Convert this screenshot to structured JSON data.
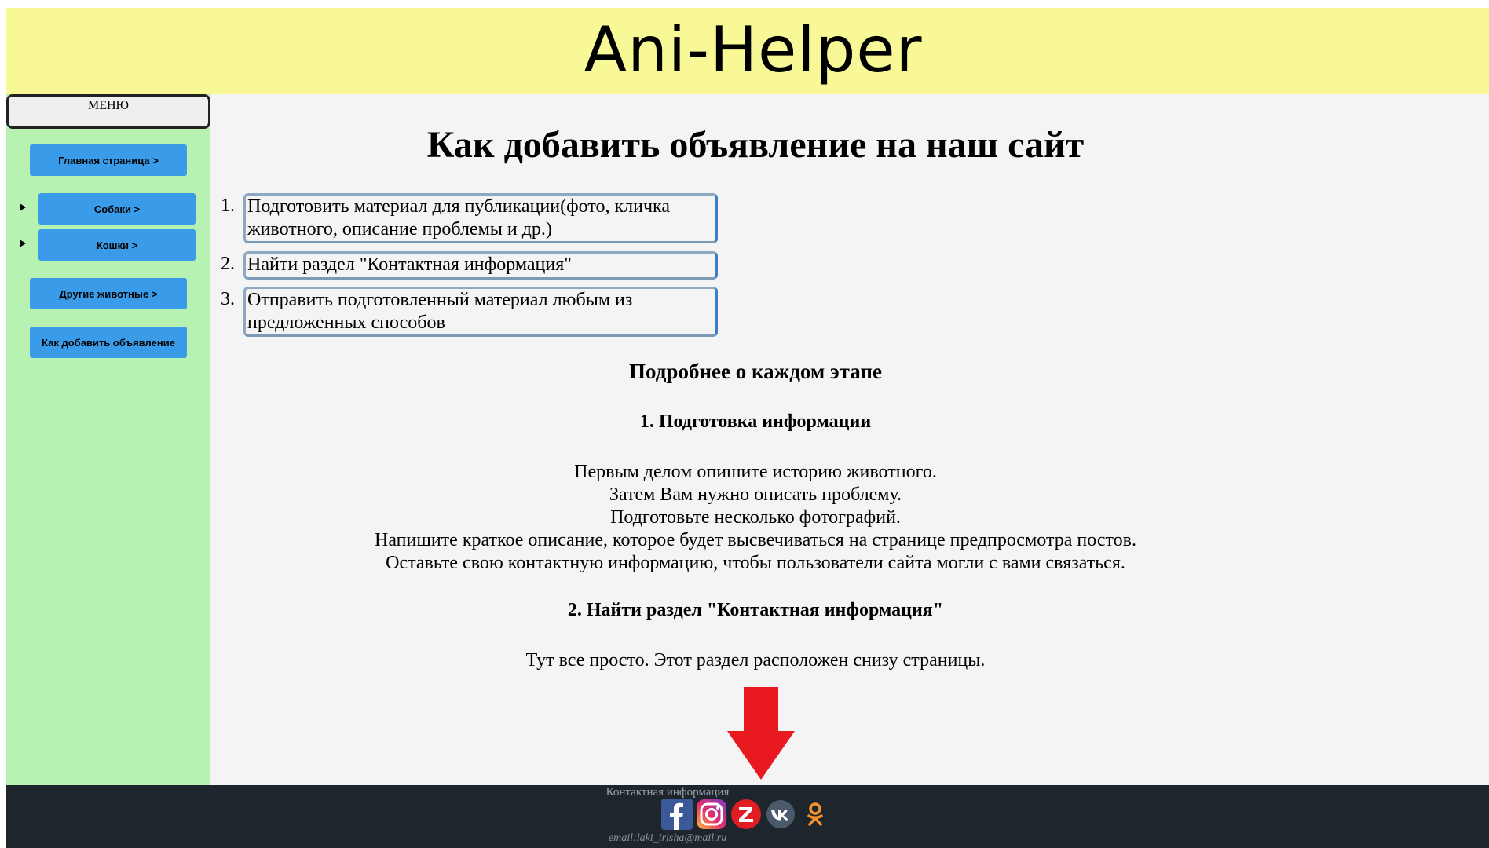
{
  "header": {
    "site_title": "Ani-Helper"
  },
  "sidebar": {
    "menu_label": "МЕНЮ",
    "items": [
      {
        "label": "Главная страница >"
      },
      {
        "label": "Собаки >"
      },
      {
        "label": "Кошки >"
      },
      {
        "label": "Другие животные >"
      },
      {
        "label": "Как добавить объявление"
      }
    ]
  },
  "main": {
    "page_title": "Как добавить объявление на наш сайт",
    "steps": [
      {
        "number": "1.",
        "text": "Подготовить материал для публикации(фото, кличка животного, описание проблемы и др.)"
      },
      {
        "number": "2.",
        "text": "Найти раздел \"Контактная информация\""
      },
      {
        "number": "3.",
        "text": "Отправить подготовленный материал любым из предложенных способов"
      }
    ],
    "details_heading": "Подробнее о каждом этапе",
    "section1": {
      "heading": "1. Подготовка информации",
      "lines": [
        "Первым делом опишите историю животного.",
        "Затем Вам нужно описать проблему.",
        "Подготовьте несколько фотографий.",
        "Напишите краткое описание, которое будет высвечиваться на странице предпросмотра постов.",
        "Оставьте свою контактную информацию, чтобы пользователи сайта могли с вами связаться."
      ]
    },
    "section2": {
      "heading": "2. Найти раздел \"Контактная информация\"",
      "text": "Тут все просто. Этот раздел расположен снизу страницы."
    }
  },
  "footer": {
    "title": "Контактная информация",
    "email": "email:laki_irisha@mail.ru",
    "socials": [
      "facebook-icon",
      "instagram-icon",
      "zen-icon",
      "vk-icon",
      "odnoklassniki-icon"
    ]
  },
  "colors": {
    "header_bg": "#f8f897",
    "sidebar_bg": "#b7f2b3",
    "main_bg": "#f4f4f4",
    "button_bg": "#3a9ce8",
    "footer_bg": "#1f252d",
    "arrow": "#e8191f"
  }
}
